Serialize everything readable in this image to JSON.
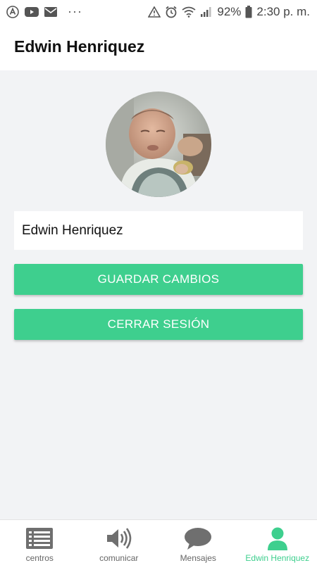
{
  "status_bar": {
    "battery": "92%",
    "time": "2:30 p. m.",
    "dots": "···"
  },
  "header": {
    "title": "Edwin Henriquez"
  },
  "profile": {
    "name_value": "Edwin Henriquez",
    "save_label": "GUARDAR CAMBIOS",
    "logout_label": "CERRAR SESIÓN"
  },
  "bottom_nav": {
    "items": [
      {
        "label": "centros",
        "icon": "list-icon",
        "active": false
      },
      {
        "label": "comunicar",
        "icon": "speaker-icon",
        "active": false
      },
      {
        "label": "Mensajes",
        "icon": "chat-bubble-icon",
        "active": false
      },
      {
        "label": "Edwin Henriquez",
        "icon": "user-icon",
        "active": true
      }
    ]
  },
  "colors": {
    "accent": "#3ecf8e",
    "background": "#f2f3f5",
    "icon_gray": "#6f6f6f"
  }
}
